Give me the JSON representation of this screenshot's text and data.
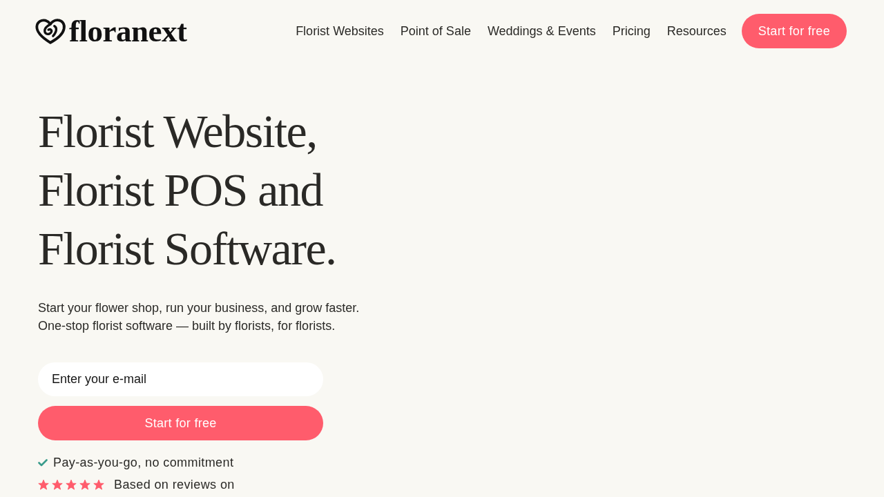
{
  "header": {
    "logo": {
      "name": "floranext"
    },
    "nav": [
      {
        "label": "Florist Websites"
      },
      {
        "label": "Point of Sale"
      },
      {
        "label": "Weddings & Events"
      },
      {
        "label": "Pricing"
      },
      {
        "label": "Resources"
      }
    ],
    "cta_button": "Start for free"
  },
  "hero": {
    "headline": [
      "Florist Website,",
      "Florist POS and",
      "Florist Software."
    ],
    "subtitle": [
      "Start your flower shop, run your business, and grow faster.",
      "One-stop florist software — built by florists, for florists."
    ],
    "email_field": {
      "placeholder": "Enter your e-mail"
    },
    "submit_button": "Start for free",
    "benefits": [
      {
        "text": "Pay-as-you-go, no commitment"
      }
    ],
    "rating": {
      "stars": 5,
      "text": "Based on reviews on"
    }
  }
}
